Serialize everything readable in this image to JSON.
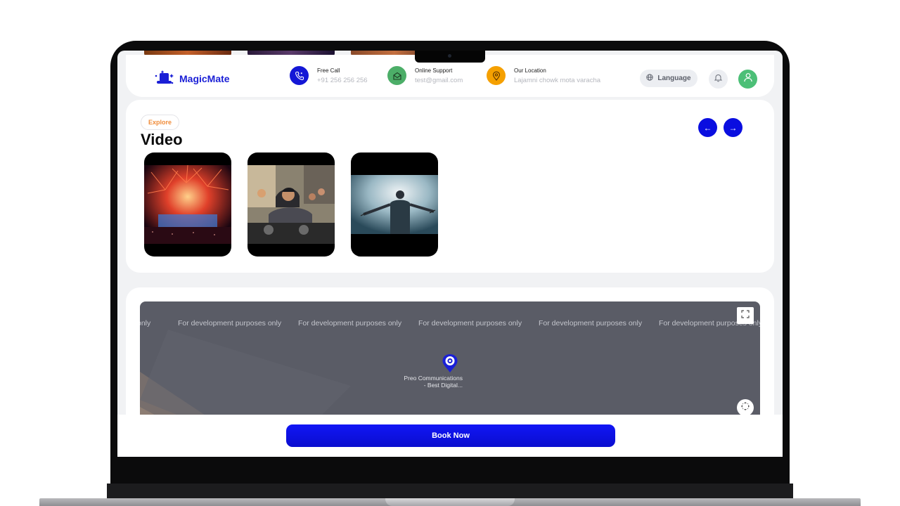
{
  "app": {
    "name": "MagicMate"
  },
  "header": {
    "contacts": [
      {
        "title": "Free Call",
        "value": "+91 256 256 256",
        "icon": "phone-icon",
        "color": "#1417d6"
      },
      {
        "title": "Online Support",
        "value": "test@gmail.com",
        "icon": "mail-icon",
        "color": "#4cae68"
      },
      {
        "title": "Our Location",
        "value": "Lajamni chowk mota varacha",
        "icon": "location-pin-icon",
        "color": "#f5a000"
      }
    ],
    "language_label": "Language",
    "bell_icon": "bell-icon",
    "avatar_icon": "user-icon"
  },
  "video_section": {
    "badge": "Explore",
    "title": "Video",
    "prev_icon": "arrow-left-icon",
    "next_icon": "arrow-right-icon",
    "prev_glyph": "←",
    "next_glyph": "→",
    "videos": [
      {
        "scene": "fireworks concert"
      },
      {
        "scene": "dj at mixer"
      },
      {
        "scene": "performer in smoke"
      }
    ]
  },
  "map": {
    "watermark": "For development purposes only",
    "watermark_partial": "only",
    "place_name_line1": "Preo Communications",
    "place_name_line2": "- Best Digital..."
  },
  "footer": {
    "book_label": "Book Now"
  },
  "colors": {
    "accent": "#0a0ee0",
    "badge_text": "#f08c3a",
    "success": "#4cbf77"
  }
}
